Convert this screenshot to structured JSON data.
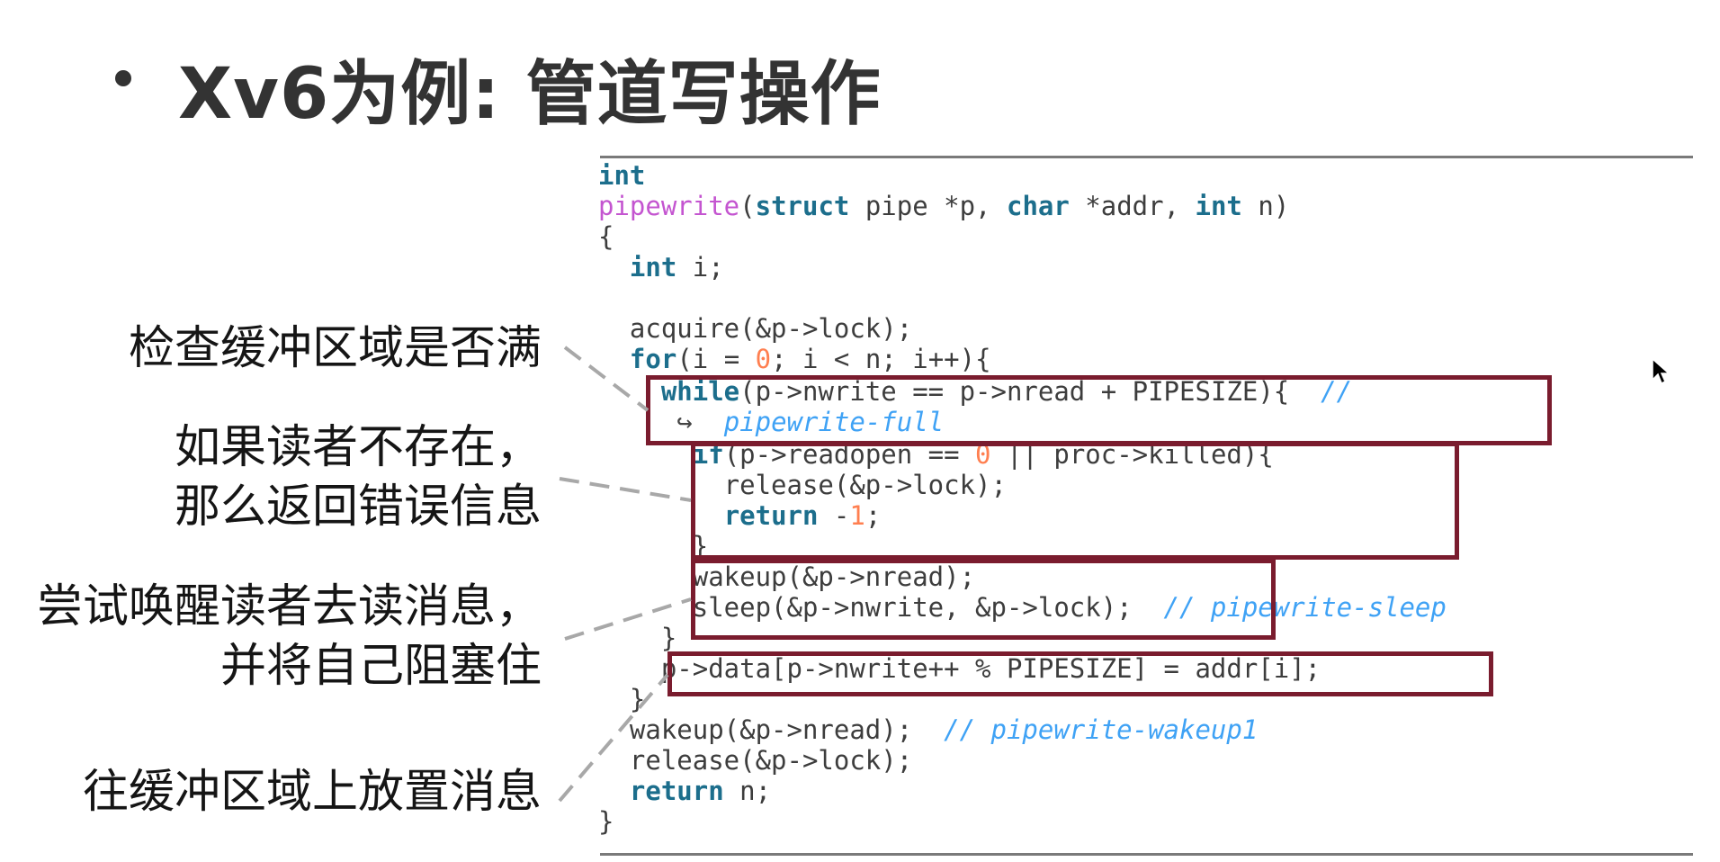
{
  "slide": {
    "title": "Xv6为例: 管道写操作"
  },
  "code": {
    "lines": [
      [
        {
          "t": "int",
          "c": "kw"
        }
      ],
      [
        {
          "t": "pipewrite",
          "c": "fn"
        },
        {
          "t": "("
        },
        {
          "t": "struct",
          "c": "kw"
        },
        {
          "t": " pipe *p, "
        },
        {
          "t": "char",
          "c": "kw"
        },
        {
          "t": " *addr, "
        },
        {
          "t": "int",
          "c": "kw"
        },
        {
          "t": " n)"
        }
      ],
      [
        {
          "t": "{"
        }
      ],
      [
        {
          "t": "  "
        },
        {
          "t": "int",
          "c": "kw"
        },
        {
          "t": " i;"
        }
      ],
      [
        {
          "t": ""
        }
      ],
      [
        {
          "t": "  acquire(&p->lock);"
        }
      ],
      [
        {
          "t": "  "
        },
        {
          "t": "for",
          "c": "kw"
        },
        {
          "t": "(i = "
        },
        {
          "t": "0",
          "c": "num"
        },
        {
          "t": "; i < n; i++){"
        }
      ],
      [
        {
          "t": "    "
        },
        {
          "t": "while",
          "c": "kw"
        },
        {
          "t": "(p->nwrite == p->nread + PIPESIZE){  "
        },
        {
          "t": "//",
          "c": "cm"
        }
      ],
      [
        {
          "t": "     ↪  ",
          "c": "arrow-glyph"
        },
        {
          "t": "pipewrite-full",
          "c": "cm"
        }
      ],
      [
        {
          "t": "      "
        },
        {
          "t": "if",
          "c": "kw"
        },
        {
          "t": "(p->readopen == "
        },
        {
          "t": "0",
          "c": "num"
        },
        {
          "t": " || proc->killed){"
        }
      ],
      [
        {
          "t": "        release(&p->lock);"
        }
      ],
      [
        {
          "t": "        "
        },
        {
          "t": "return",
          "c": "kw"
        },
        {
          "t": " -"
        },
        {
          "t": "1",
          "c": "num"
        },
        {
          "t": ";"
        }
      ],
      [
        {
          "t": "      }"
        }
      ],
      [
        {
          "t": "      wakeup(&p->nread);"
        }
      ],
      [
        {
          "t": "      sleep(&p->nwrite, &p->lock);  "
        },
        {
          "t": "// pipewrite-sleep",
          "c": "cm"
        }
      ],
      [
        {
          "t": "    }"
        }
      ],
      [
        {
          "t": "    p->data[p->nwrite++ % PIPESIZE] = addr[i];"
        }
      ],
      [
        {
          "t": "  }"
        }
      ],
      [
        {
          "t": "  wakeup(&p->nread);  "
        },
        {
          "t": "// pipewrite-wakeup1",
          "c": "cm"
        }
      ],
      [
        {
          "t": "  release(&p->lock);"
        }
      ],
      [
        {
          "t": "  "
        },
        {
          "t": "return",
          "c": "kw"
        },
        {
          "t": " n;"
        }
      ],
      [
        {
          "t": "}"
        }
      ]
    ]
  },
  "annotations": {
    "check_full": "检查缓冲区域是否满",
    "no_reader_line1": "如果读者不存在，",
    "no_reader_line2": "那么返回错误信息",
    "wake_reader_line1": "尝试唤醒读者去读消息，",
    "wake_reader_line2": "并将自己阻塞住",
    "put_message": "往缓冲区域上放置消息"
  },
  "colors": {
    "keyword": "#1c6e8c",
    "function_name": "#c455d0",
    "number": "#ff7f50",
    "comment": "#3fa2f5",
    "highlight_box": "#7a1c2e",
    "leader_line": "#a8a8a8"
  },
  "icons": {
    "cursor": "mouse-pointer-icon",
    "bullet": "bullet-dot-icon"
  }
}
